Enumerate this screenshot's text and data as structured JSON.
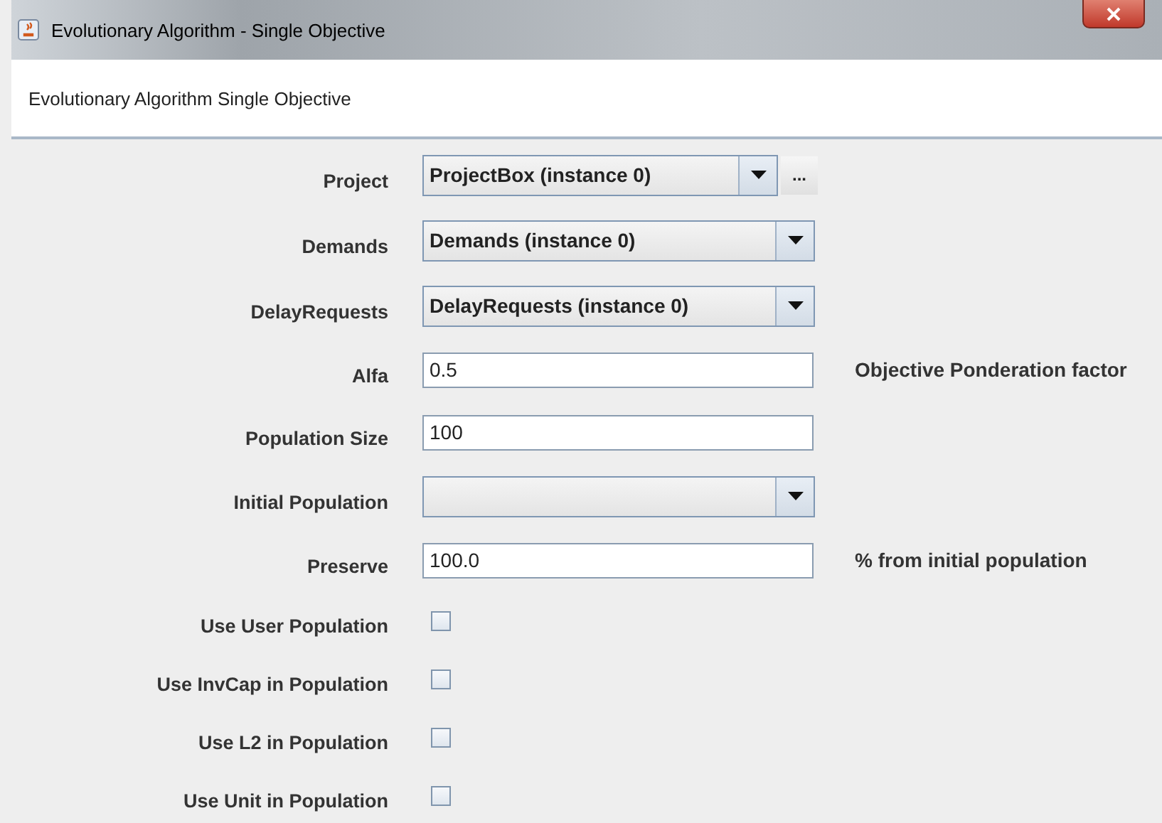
{
  "window": {
    "title": "Evolutionary Algorithm - Single Objective"
  },
  "header": {
    "text": "Evolutionary Algorithm Single Objective"
  },
  "fields": [
    {
      "kind": "combo-more",
      "label": "Project",
      "value": "ProjectBox (instance 0)",
      "more": "..."
    },
    {
      "kind": "combo",
      "label": "Demands",
      "value": "Demands (instance 0)"
    },
    {
      "kind": "combo",
      "label": "DelayRequests",
      "value": "DelayRequests (instance 0)"
    },
    {
      "kind": "text",
      "label": "Alfa",
      "value": "0.5",
      "note": "Objective Ponderation factor"
    },
    {
      "kind": "text",
      "label": "Population Size",
      "value": "100"
    },
    {
      "kind": "combo",
      "label": "Initial Population"
    },
    {
      "kind": "text",
      "label": "Preserve",
      "value": "100.0",
      "note": "% from initial population"
    },
    {
      "kind": "checkbox",
      "label": "Use User Population",
      "checked": false
    },
    {
      "kind": "checkbox",
      "label": "Use InvCap in Population",
      "checked": false
    },
    {
      "kind": "checkbox",
      "label": "Use L2 in Population",
      "checked": false
    },
    {
      "kind": "checkbox",
      "label": "Use Unit in Population",
      "checked": false
    }
  ]
}
